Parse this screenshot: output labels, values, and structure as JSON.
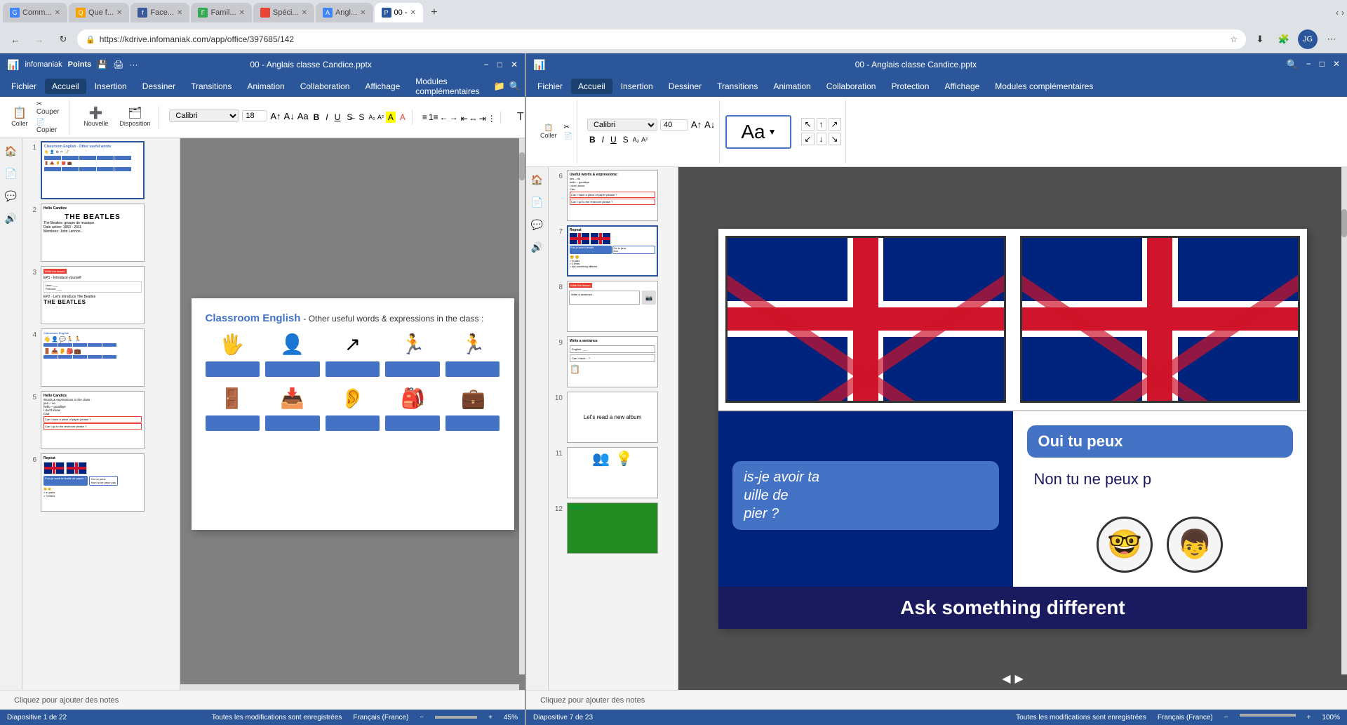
{
  "browser": {
    "tabs": [
      {
        "label": "Comm...",
        "active": false,
        "color": "#4285f4"
      },
      {
        "label": "Que f...",
        "active": false,
        "color": "#f4a400"
      },
      {
        "label": "Face...",
        "active": false,
        "color": "#3b5998"
      },
      {
        "label": "Famil...",
        "active": false,
        "color": "#34a853"
      },
      {
        "label": "Spéci...",
        "active": false,
        "color": "#ea4335"
      },
      {
        "label": "Angl...",
        "active": false,
        "color": "#4285f4"
      },
      {
        "label": "00 -",
        "active": true,
        "color": "#2b579a"
      }
    ],
    "address": "https://kdrive.infomaniak.com/app/office/397685/142",
    "new_tab_label": "+"
  },
  "left_app": {
    "title": "00 - Anglais classe Candice.pptx",
    "menu_items": [
      "Fichier",
      "Accueil",
      "Insertion",
      "Dessiner",
      "Transitions",
      "Animation",
      "Collaboration",
      "Affichage",
      "Modules complémentaires"
    ],
    "active_menu": "Accueil",
    "font_name": "Calibri",
    "font_size": "18",
    "current_slide": 1,
    "total_slides": 22,
    "zoom": "45%",
    "status": "Diapositive 1 de 22",
    "save_status": "Toutes les modifications sont enregistrées",
    "language": "Français (France)",
    "notes_placeholder": "Cliquez pour ajouter des notes",
    "slides": [
      {
        "num": 1,
        "title": "Classroom English",
        "subtitle": "Other useful words & expressions in the class"
      },
      {
        "num": 2,
        "title": "Hello Candice - Beatles"
      },
      {
        "num": 3,
        "title": "Write the lesson - EP1/EP2"
      },
      {
        "num": 4,
        "title": "Classroom English icons"
      },
      {
        "num": 5,
        "title": "Hello Candice - Useful words"
      },
      {
        "num": 6,
        "title": "Repeat - UK flags"
      },
      {
        "num": 7,
        "title": "Repeat pairs"
      },
      {
        "num": 8,
        "title": "Write the lesson"
      },
      {
        "num": 9,
        "title": "Write a sentence"
      },
      {
        "num": 10,
        "title": "Let's read a new album"
      },
      {
        "num": 11,
        "title": "Icons slide"
      },
      {
        "num": 12,
        "title": "Photo slide"
      }
    ],
    "main_slide": {
      "title_color": "#4472c4",
      "title": "Classroom English",
      "subtitle": "- Other useful words & expressions in the class :"
    }
  },
  "right_app": {
    "title": "00 - Anglais classe Candice.pptx",
    "menu_items": [
      "Fichier",
      "Accueil",
      "Insertion",
      "Dessiner",
      "Transitions",
      "Animation",
      "Collaboration",
      "Protection",
      "Affichage",
      "Modules complémentaires"
    ],
    "active_menu": "Accueil",
    "font_name": "Calibri",
    "font_size": "40",
    "current_slide": 7,
    "total_slides": 23,
    "zoom": "100%",
    "status": "Diapositive 7 de 23",
    "save_status": "Toutes les modifications sont enregistrées",
    "language": "Français (France)",
    "notes_placeholder": "Cliquez pour ajouter des notes",
    "slides": [
      {
        "num": 6,
        "title": "Useful words slide 6"
      },
      {
        "num": 7,
        "title": "Repeat - UK flags (current)"
      },
      {
        "num": 8,
        "title": "Write the lesson"
      },
      {
        "num": 9,
        "title": "Write a sentence"
      },
      {
        "num": 10,
        "title": "Let's read a new album"
      },
      {
        "num": 11,
        "title": "Icons"
      },
      {
        "num": 12,
        "title": "Forest photo"
      }
    ],
    "slide7": {
      "header": "Repeat",
      "flag_labels": [
        "Puis-je avoir ta feuille de papier ?",
        "Oui tu peux",
        "Non tu ne peux pas"
      ],
      "instruction1": "> in pairs",
      "instruction2": "> 3 times",
      "instruction3": "> Ask something different each time",
      "bubble_left_top": "Puis-je avoir ta feuille de papier ?",
      "bubble_right_top": "Oui tu peux",
      "bubble_right_bot": "Non tu ne peux p",
      "ask_different": "Ask something different"
    },
    "slide10": {
      "text": "Let - read anew album",
      "full_text": "Let's read a new album"
    }
  }
}
